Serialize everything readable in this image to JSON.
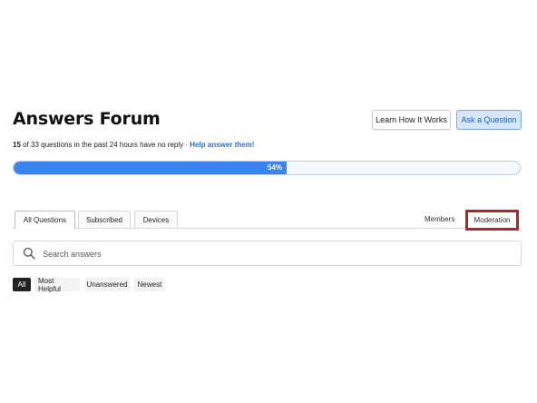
{
  "header": {
    "title": "Answers Forum",
    "learn_button": "Learn How It Works",
    "ask_button": "Ask a Question"
  },
  "stats": {
    "unanswered_count": "15",
    "text": " of 33 questions in the past 24 hours have no reply · ",
    "help_link": "Help answer them!"
  },
  "progress": {
    "label": "54%",
    "fraction": 0.54
  },
  "tabs": {
    "items": [
      "All Questions",
      "Subscribed",
      "Devices"
    ],
    "active": "All Questions",
    "right_items": [
      "Members",
      "Moderation"
    ]
  },
  "search": {
    "placeholder": "Search answers",
    "value": ""
  },
  "filters": {
    "items": [
      "All",
      "Most Helpful",
      "Unanswered",
      "Newest"
    ],
    "active": "All"
  },
  "colors": {
    "accent": "#3a84f0",
    "highlight_border": "#b3261e",
    "link": "#2a6fd6"
  }
}
